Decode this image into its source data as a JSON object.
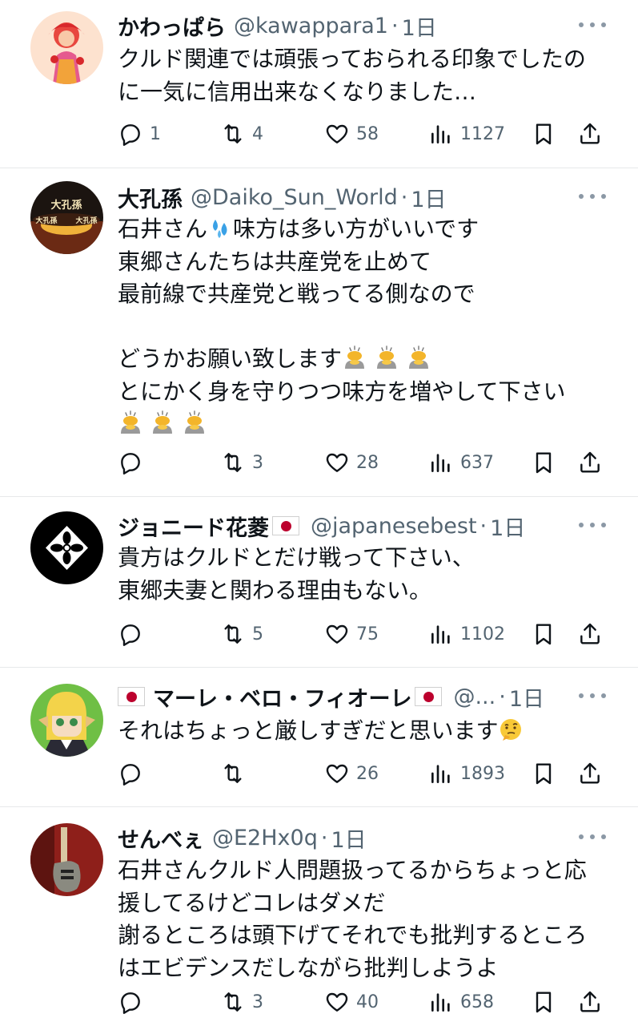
{
  "tweets": [
    {
      "name": "かわっぱら",
      "handle": "@kawappara1",
      "time": "1日",
      "lines": [
        "クルド関連では頑張っておられる印象でしたの",
        "に一気に信用出来なくなりました…"
      ],
      "reply": "1",
      "retweet": "4",
      "like": "58",
      "views": "1127"
    },
    {
      "name": "大孔孫",
      "handle": "@Daiko_Sun_World",
      "time": "1日",
      "line1_pre": "石井さん",
      "line1_post": "味方は多い方がいいです",
      "lines": [
        "東郷さんたちは共産党を止めて",
        "最前線で共産党と戦ってる側なので"
      ],
      "line5": "どうかお願い致します",
      "line6": "とにかく身を守りつつ味方を増やして下さい",
      "avatar_text": "大孔孫",
      "reply": "",
      "retweet": "3",
      "like": "28",
      "views": "637"
    },
    {
      "name": "ジョニード花菱",
      "handle": "@japanesebest",
      "time": "1日",
      "lines": [
        "貴方はクルドとだけ戦って下さい、",
        "東郷夫妻と関わる理由もない。"
      ],
      "reply": "",
      "retweet": "5",
      "like": "75",
      "views": "1102"
    },
    {
      "name": "マーレ・ベロ・フィオーレ",
      "handle": "@...",
      "time": "1日",
      "line1": "それはちょっと厳しすぎだと思います",
      "reply": "",
      "retweet": "",
      "like": "26",
      "views": "1893"
    },
    {
      "name": "せんべぇ",
      "handle": "@E2Hx0q",
      "time": "1日",
      "lines": [
        "石井さんクルド人問題扱ってるからちょっと応",
        "援してるけどコレはダメだ",
        "謝るところは頭下げてそれでも批判するところ",
        "はエビデンスだしながら批判しようよ"
      ],
      "reply": "",
      "retweet": "3",
      "like": "40",
      "views": "658"
    }
  ],
  "icons": {
    "reply": "reply-icon",
    "retweet": "retweet-icon",
    "like": "heart-icon",
    "views": "views-icon",
    "bookmark": "bookmark-icon",
    "share": "share-icon",
    "more": "more-icon",
    "sweat": "sweat-droplets-emoji",
    "bow": "bowing-person-emoji",
    "thinking": "thinking-face-emoji",
    "flag": "japan-flag-emoji"
  },
  "colors": {
    "text": "#0f1419",
    "secondary": "#536471",
    "divider": "#e7e9ea"
  }
}
